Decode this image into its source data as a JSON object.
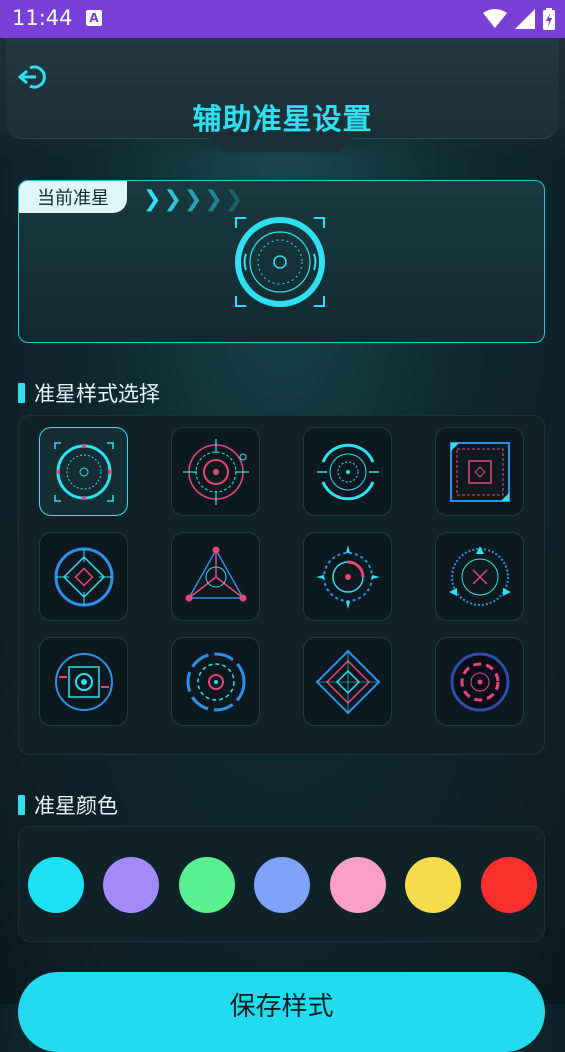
{
  "status_bar": {
    "time": "11:44",
    "notification_icon": "a-icon",
    "icons": [
      "wifi-icon",
      "signal-icon",
      "battery-charging-icon"
    ]
  },
  "header": {
    "title": "辅助准星设置",
    "back_icon": "back-arrow-icon"
  },
  "current": {
    "label": "当前准星",
    "chevron_icons": [
      "chevron-right-icon",
      "chevron-right-icon",
      "chevron-right-icon",
      "chevron-right-icon",
      "chevron-right-icon"
    ]
  },
  "style_section": {
    "title": "准星样式选择",
    "selected_index": 0,
    "styles": [
      "crosshair-style-1",
      "crosshair-style-2",
      "crosshair-style-3",
      "crosshair-style-4",
      "crosshair-style-5",
      "crosshair-style-6",
      "crosshair-style-7",
      "crosshair-style-8",
      "crosshair-style-9",
      "crosshair-style-10",
      "crosshair-style-11",
      "crosshair-style-12"
    ]
  },
  "color_section": {
    "title": "准星颜色",
    "colors": [
      "#1de1f7",
      "#a28af9",
      "#5af191",
      "#7fa3fb",
      "#fc9fc8",
      "#f6dc4c",
      "#fc2f2f"
    ]
  },
  "save": {
    "label": "保存样式"
  },
  "theme": {
    "accent": "#2ee0f2",
    "pink": "#e8467a"
  }
}
